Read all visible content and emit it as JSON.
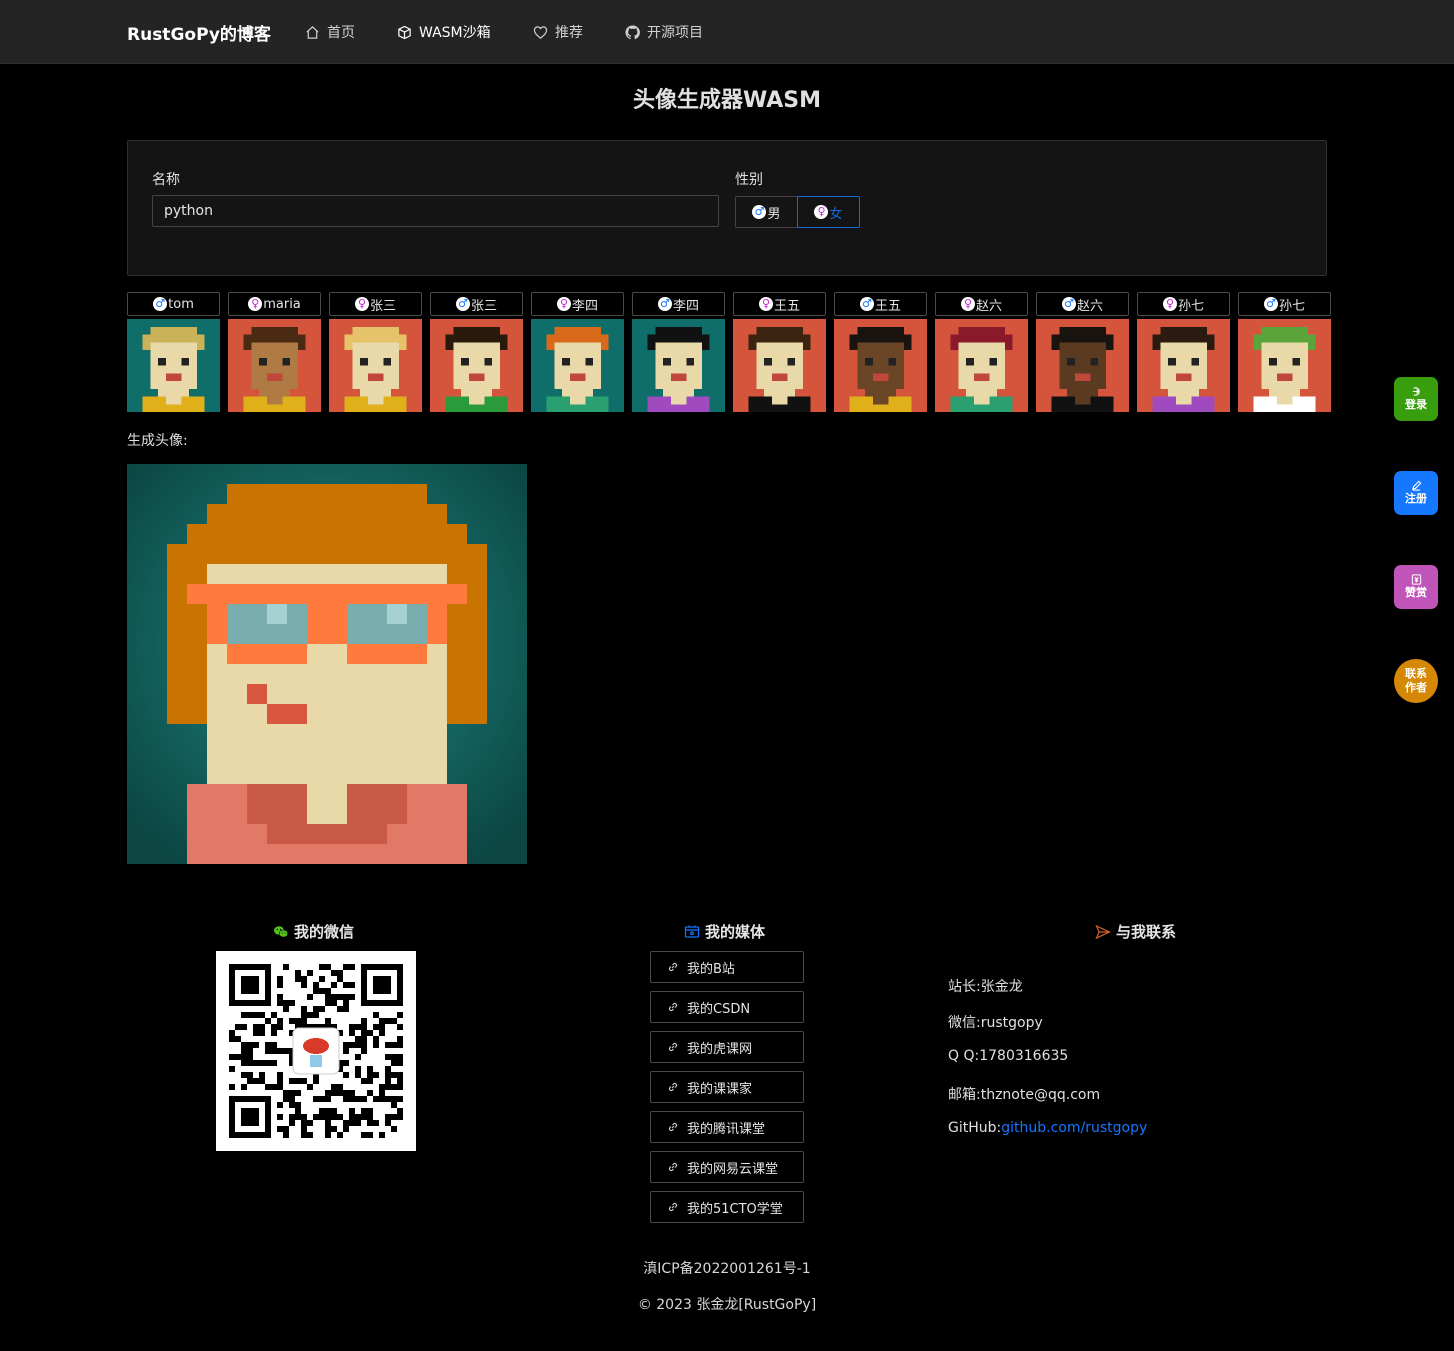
{
  "nav": {
    "brand": "RustGoPy的博客",
    "items": [
      {
        "label": "首页",
        "icon": "home-icon"
      },
      {
        "label": "WASM沙箱",
        "icon": "cube-icon"
      },
      {
        "label": "推荐",
        "icon": "heart-icon"
      },
      {
        "label": "开源项目",
        "icon": "github-icon"
      }
    ]
  },
  "page": {
    "title": "头像生成器WASM"
  },
  "form": {
    "name_label": "名称",
    "name_value": "python",
    "gender_label": "性别",
    "gender_male": "男",
    "gender_female": "女",
    "gender_selected": "女"
  },
  "presets": [
    {
      "name": "tom",
      "gender": "male"
    },
    {
      "name": "maria",
      "gender": "female"
    },
    {
      "name": "张三",
      "gender": "female"
    },
    {
      "name": "张三",
      "gender": "male"
    },
    {
      "name": "李四",
      "gender": "female"
    },
    {
      "name": "李四",
      "gender": "male"
    },
    {
      "name": "王五",
      "gender": "female"
    },
    {
      "name": "王五",
      "gender": "male"
    },
    {
      "name": "赵六",
      "gender": "female"
    },
    {
      "name": "赵六",
      "gender": "male"
    },
    {
      "name": "孙七",
      "gender": "female"
    },
    {
      "name": "孙七",
      "gender": "male"
    }
  ],
  "generated": {
    "label": "生成头像:"
  },
  "floating": {
    "login": "登录",
    "register": "注册",
    "donate": "赞赏",
    "contact_line1": "联系",
    "contact_line2": "作者"
  },
  "footer": {
    "wechat_title": "我的微信",
    "media_title": "我的媒体",
    "contact_title": "与我联系",
    "media_links": [
      "我的B站",
      "我的CSDN",
      "我的虎课网",
      "我的课课家",
      "我的腾讯课堂",
      "我的网易云课堂",
      "我的51CTO学堂"
    ],
    "contact": {
      "owner_label": "站长:",
      "owner": "张金龙",
      "wechat_label": "微信:",
      "wechat": "rustgopy",
      "qq_label": "Q Q:",
      "qq": "1780316635",
      "email_label": "邮箱:",
      "email": "thznote@qq.com",
      "github_label": "GitHub:",
      "github": "github.com/rustgopy"
    },
    "icp": "滇ICP备2022001261号-1",
    "copyright": "© 2023 张金龙[RustGoPy]"
  },
  "colors": {
    "accent": "#1668dc",
    "login": "#389e0d",
    "register": "#1677ff",
    "donate": "#c054b8",
    "contact": "#d48806"
  }
}
